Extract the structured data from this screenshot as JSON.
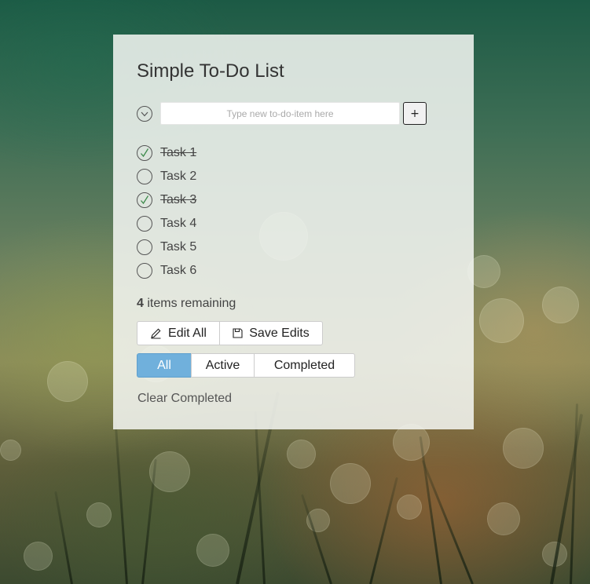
{
  "app": {
    "title": "Simple To-Do List"
  },
  "new_item": {
    "placeholder": "Type new to-do-item here",
    "value": "",
    "add_label": "+"
  },
  "todos": [
    {
      "label": "Task 1",
      "completed": true
    },
    {
      "label": "Task 2",
      "completed": false
    },
    {
      "label": "Task 3",
      "completed": true
    },
    {
      "label": "Task 4",
      "completed": false
    },
    {
      "label": "Task 5",
      "completed": false
    },
    {
      "label": "Task 6",
      "completed": false
    }
  ],
  "footer": {
    "remaining_count": "4",
    "remaining_text": " items remaining"
  },
  "edit_buttons": {
    "edit_all": "Edit All",
    "save_edits": "Save Edits"
  },
  "filters": {
    "all": "All",
    "active": "Active",
    "completed": "Completed",
    "selected": "All"
  },
  "clear_completed": "Clear Completed",
  "colors": {
    "accent": "#70b0dc",
    "check": "#3c8a4a"
  },
  "icons": {
    "toggle_all": "chevron-down-circle-icon",
    "complete": "checkmark-icon",
    "edit": "pencil-icon",
    "save": "floppy-disk-icon"
  }
}
